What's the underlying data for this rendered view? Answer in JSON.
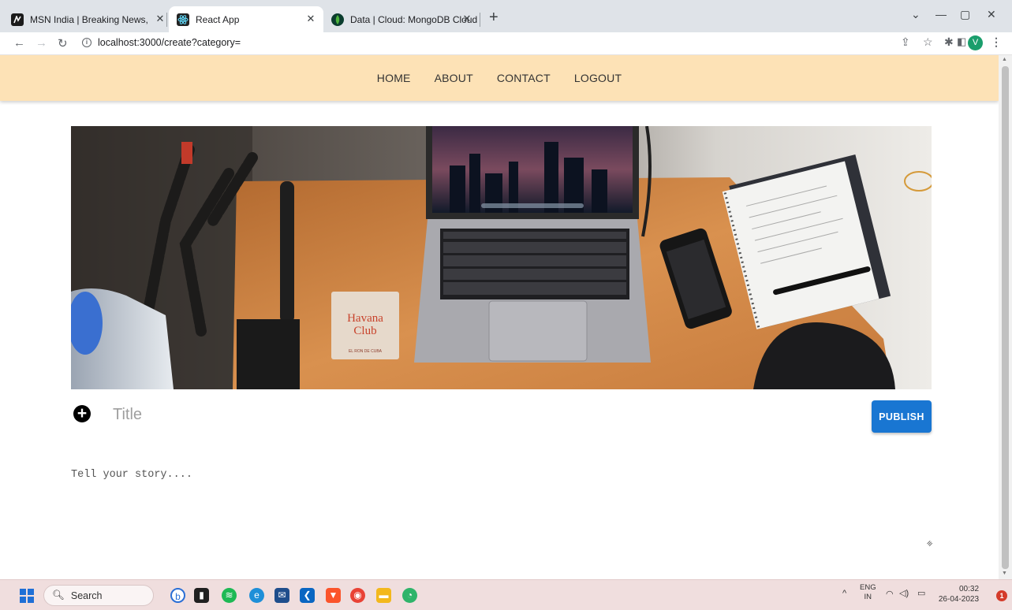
{
  "browser": {
    "tabs": [
      {
        "label": "MSN India | Breaking News, Ente",
        "icon": "msn-icon"
      },
      {
        "label": "React App",
        "icon": "react-icon",
        "active": true
      },
      {
        "label": "Data | Cloud: MongoDB Cloud",
        "icon": "mongodb-icon"
      }
    ],
    "new_tab_label": "+",
    "url": "localhost:3000/create?category=",
    "profile_initial": "V"
  },
  "topnav": {
    "items": [
      "HOME",
      "ABOUT",
      "CONTACT",
      "LOGOUT"
    ]
  },
  "banner": {
    "coaster_line1": "Havana",
    "coaster_line2": "Club",
    "coaster_line3": "EL RON DE CUBA"
  },
  "editor": {
    "title_placeholder": "Title",
    "publish_label": "PUBLISH",
    "story_placeholder": "Tell your story...."
  },
  "taskbar": {
    "search_label": "Search",
    "lang_top": "ENG",
    "lang_bottom": "IN",
    "time": "00:32",
    "date": "26-04-2023",
    "notification_count": "1"
  },
  "colors": {
    "nav_bg": "#fde2b6",
    "publish_bg": "#1976d2",
    "taskbar_bg": "#f0dede"
  }
}
